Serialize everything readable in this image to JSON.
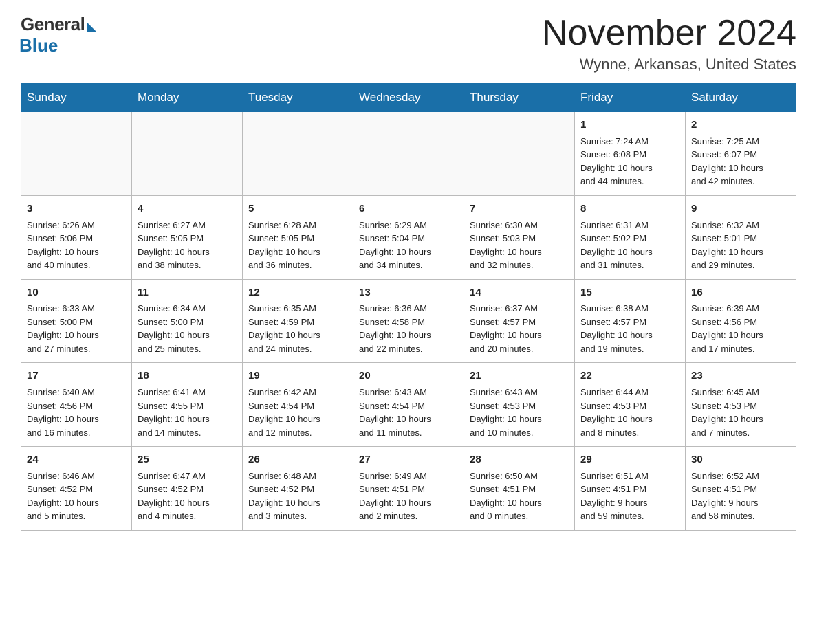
{
  "header": {
    "logo_general": "General",
    "logo_blue": "Blue",
    "month_title": "November 2024",
    "location": "Wynne, Arkansas, United States"
  },
  "days_of_week": [
    "Sunday",
    "Monday",
    "Tuesday",
    "Wednesday",
    "Thursday",
    "Friday",
    "Saturday"
  ],
  "weeks": [
    [
      {
        "day": "",
        "info": ""
      },
      {
        "day": "",
        "info": ""
      },
      {
        "day": "",
        "info": ""
      },
      {
        "day": "",
        "info": ""
      },
      {
        "day": "",
        "info": ""
      },
      {
        "day": "1",
        "info": "Sunrise: 7:24 AM\nSunset: 6:08 PM\nDaylight: 10 hours\nand 44 minutes."
      },
      {
        "day": "2",
        "info": "Sunrise: 7:25 AM\nSunset: 6:07 PM\nDaylight: 10 hours\nand 42 minutes."
      }
    ],
    [
      {
        "day": "3",
        "info": "Sunrise: 6:26 AM\nSunset: 5:06 PM\nDaylight: 10 hours\nand 40 minutes."
      },
      {
        "day": "4",
        "info": "Sunrise: 6:27 AM\nSunset: 5:05 PM\nDaylight: 10 hours\nand 38 minutes."
      },
      {
        "day": "5",
        "info": "Sunrise: 6:28 AM\nSunset: 5:05 PM\nDaylight: 10 hours\nand 36 minutes."
      },
      {
        "day": "6",
        "info": "Sunrise: 6:29 AM\nSunset: 5:04 PM\nDaylight: 10 hours\nand 34 minutes."
      },
      {
        "day": "7",
        "info": "Sunrise: 6:30 AM\nSunset: 5:03 PM\nDaylight: 10 hours\nand 32 minutes."
      },
      {
        "day": "8",
        "info": "Sunrise: 6:31 AM\nSunset: 5:02 PM\nDaylight: 10 hours\nand 31 minutes."
      },
      {
        "day": "9",
        "info": "Sunrise: 6:32 AM\nSunset: 5:01 PM\nDaylight: 10 hours\nand 29 minutes."
      }
    ],
    [
      {
        "day": "10",
        "info": "Sunrise: 6:33 AM\nSunset: 5:00 PM\nDaylight: 10 hours\nand 27 minutes."
      },
      {
        "day": "11",
        "info": "Sunrise: 6:34 AM\nSunset: 5:00 PM\nDaylight: 10 hours\nand 25 minutes."
      },
      {
        "day": "12",
        "info": "Sunrise: 6:35 AM\nSunset: 4:59 PM\nDaylight: 10 hours\nand 24 minutes."
      },
      {
        "day": "13",
        "info": "Sunrise: 6:36 AM\nSunset: 4:58 PM\nDaylight: 10 hours\nand 22 minutes."
      },
      {
        "day": "14",
        "info": "Sunrise: 6:37 AM\nSunset: 4:57 PM\nDaylight: 10 hours\nand 20 minutes."
      },
      {
        "day": "15",
        "info": "Sunrise: 6:38 AM\nSunset: 4:57 PM\nDaylight: 10 hours\nand 19 minutes."
      },
      {
        "day": "16",
        "info": "Sunrise: 6:39 AM\nSunset: 4:56 PM\nDaylight: 10 hours\nand 17 minutes."
      }
    ],
    [
      {
        "day": "17",
        "info": "Sunrise: 6:40 AM\nSunset: 4:56 PM\nDaylight: 10 hours\nand 16 minutes."
      },
      {
        "day": "18",
        "info": "Sunrise: 6:41 AM\nSunset: 4:55 PM\nDaylight: 10 hours\nand 14 minutes."
      },
      {
        "day": "19",
        "info": "Sunrise: 6:42 AM\nSunset: 4:54 PM\nDaylight: 10 hours\nand 12 minutes."
      },
      {
        "day": "20",
        "info": "Sunrise: 6:43 AM\nSunset: 4:54 PM\nDaylight: 10 hours\nand 11 minutes."
      },
      {
        "day": "21",
        "info": "Sunrise: 6:43 AM\nSunset: 4:53 PM\nDaylight: 10 hours\nand 10 minutes."
      },
      {
        "day": "22",
        "info": "Sunrise: 6:44 AM\nSunset: 4:53 PM\nDaylight: 10 hours\nand 8 minutes."
      },
      {
        "day": "23",
        "info": "Sunrise: 6:45 AM\nSunset: 4:53 PM\nDaylight: 10 hours\nand 7 minutes."
      }
    ],
    [
      {
        "day": "24",
        "info": "Sunrise: 6:46 AM\nSunset: 4:52 PM\nDaylight: 10 hours\nand 5 minutes."
      },
      {
        "day": "25",
        "info": "Sunrise: 6:47 AM\nSunset: 4:52 PM\nDaylight: 10 hours\nand 4 minutes."
      },
      {
        "day": "26",
        "info": "Sunrise: 6:48 AM\nSunset: 4:52 PM\nDaylight: 10 hours\nand 3 minutes."
      },
      {
        "day": "27",
        "info": "Sunrise: 6:49 AM\nSunset: 4:51 PM\nDaylight: 10 hours\nand 2 minutes."
      },
      {
        "day": "28",
        "info": "Sunrise: 6:50 AM\nSunset: 4:51 PM\nDaylight: 10 hours\nand 0 minutes."
      },
      {
        "day": "29",
        "info": "Sunrise: 6:51 AM\nSunset: 4:51 PM\nDaylight: 9 hours\nand 59 minutes."
      },
      {
        "day": "30",
        "info": "Sunrise: 6:52 AM\nSunset: 4:51 PM\nDaylight: 9 hours\nand 58 minutes."
      }
    ]
  ]
}
